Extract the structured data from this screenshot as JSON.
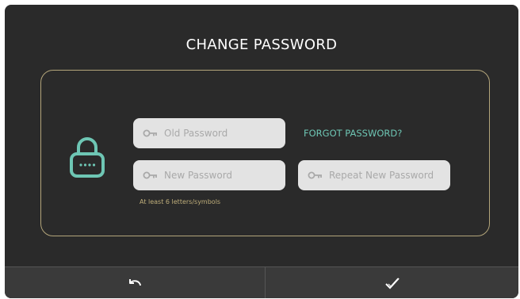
{
  "title": "CHANGE PASSWORD",
  "fields": {
    "old_password": {
      "placeholder": "Old Password",
      "value": ""
    },
    "new_password": {
      "placeholder": "New Password",
      "value": ""
    },
    "repeat_password": {
      "placeholder": "Repeat New Password",
      "value": ""
    }
  },
  "forgot_link": "FORGOT PASSWORD?",
  "hint": "At least 6 letters/symbols",
  "icons": {
    "lock": "lock-icon",
    "field": "key-icon",
    "back": "undo-icon",
    "confirm": "checkmark-icon"
  },
  "colors": {
    "background": "#2a2a2a",
    "accent": "#6ec6b4",
    "panel_border": "#b3a57a",
    "hint": "#bfae7a",
    "field_bg": "#e3e3e3"
  }
}
